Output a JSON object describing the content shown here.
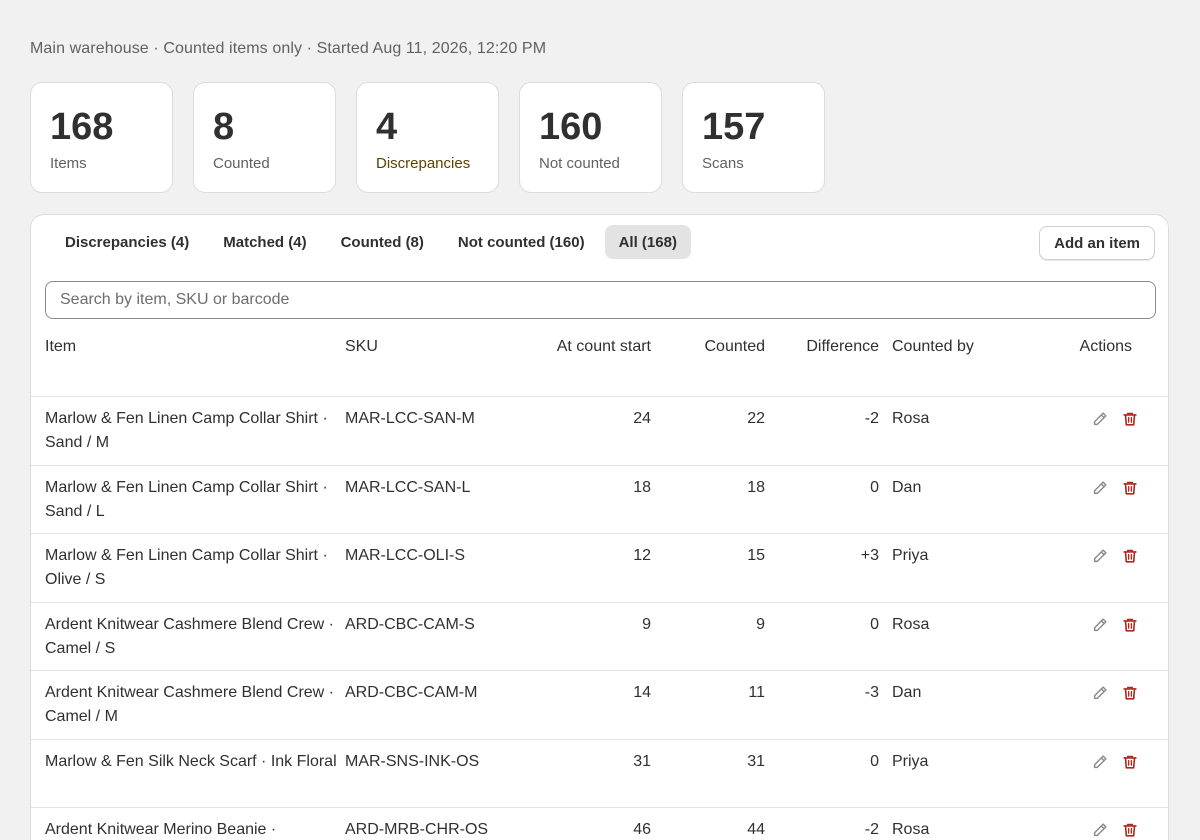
{
  "header": {
    "subtitle": "Main warehouse · Counted items only · Started Aug 11, 2026, 12:20 PM"
  },
  "stats": [
    {
      "value": "168",
      "label": "Items"
    },
    {
      "value": "8",
      "label": "Counted"
    },
    {
      "value": "4",
      "label": "Discrepancies"
    },
    {
      "value": "160",
      "label": "Not counted"
    },
    {
      "value": "157",
      "label": "Scans"
    }
  ],
  "tabs": [
    {
      "label": "Discrepancies (4)"
    },
    {
      "label": "Matched (4)"
    },
    {
      "label": "Counted (8)"
    },
    {
      "label": "Not counted (160)"
    },
    {
      "label": "All (168)"
    }
  ],
  "active_tab": "All (168)",
  "toolbar": {
    "add_label": "Add an item"
  },
  "search": {
    "placeholder": "Search by item, SKU or barcode",
    "value": ""
  },
  "table": {
    "headers": {
      "item": "Item",
      "sku": "SKU",
      "start": "At count start",
      "counted": "Counted",
      "difference": "Difference",
      "counted_by": "Counted by",
      "actions": "Actions"
    },
    "rows": [
      {
        "item": "Marlow & Fen Linen Camp Collar Shirt · Sand / M",
        "sku": "MAR-LCC-SAN-M",
        "start": "24",
        "counted": "22",
        "difference": "-2",
        "counted_by": "Rosa"
      },
      {
        "item": "Marlow & Fen Linen Camp Collar Shirt · Sand / L",
        "sku": "MAR-LCC-SAN-L",
        "start": "18",
        "counted": "18",
        "difference": "0",
        "counted_by": "Dan"
      },
      {
        "item": "Marlow & Fen Linen Camp Collar Shirt · Olive / S",
        "sku": "MAR-LCC-OLI-S",
        "start": "12",
        "counted": "15",
        "difference": "+3",
        "counted_by": "Priya"
      },
      {
        "item": "Ardent Knitwear Cashmere Blend Crew · Camel / S",
        "sku": "ARD-CBC-CAM-S",
        "start": "9",
        "counted": "9",
        "difference": "0",
        "counted_by": "Rosa"
      },
      {
        "item": "Ardent Knitwear Cashmere Blend Crew · Camel / M",
        "sku": "ARD-CBC-CAM-M",
        "start": "14",
        "counted": "11",
        "difference": "-3",
        "counted_by": "Dan"
      },
      {
        "item": "Marlow & Fen Silk Neck Scarf · Ink Floral",
        "sku": "MAR-SNS-INK-OS",
        "start": "31",
        "counted": "31",
        "difference": "0",
        "counted_by": "Priya"
      },
      {
        "item": "Ardent Knitwear Merino Beanie ·",
        "sku": "ARD-MRB-CHR-OS",
        "start": "46",
        "counted": "44",
        "difference": "-2",
        "counted_by": "Rosa"
      }
    ]
  },
  "icons": {
    "edit": "pencil-icon",
    "delete": "trash-icon"
  },
  "colors": {
    "delete": "#b3261e",
    "edit": "#8a8a8a",
    "page_bg": "#f1f1f1",
    "active_tab_bg": "#e3e3e3"
  }
}
